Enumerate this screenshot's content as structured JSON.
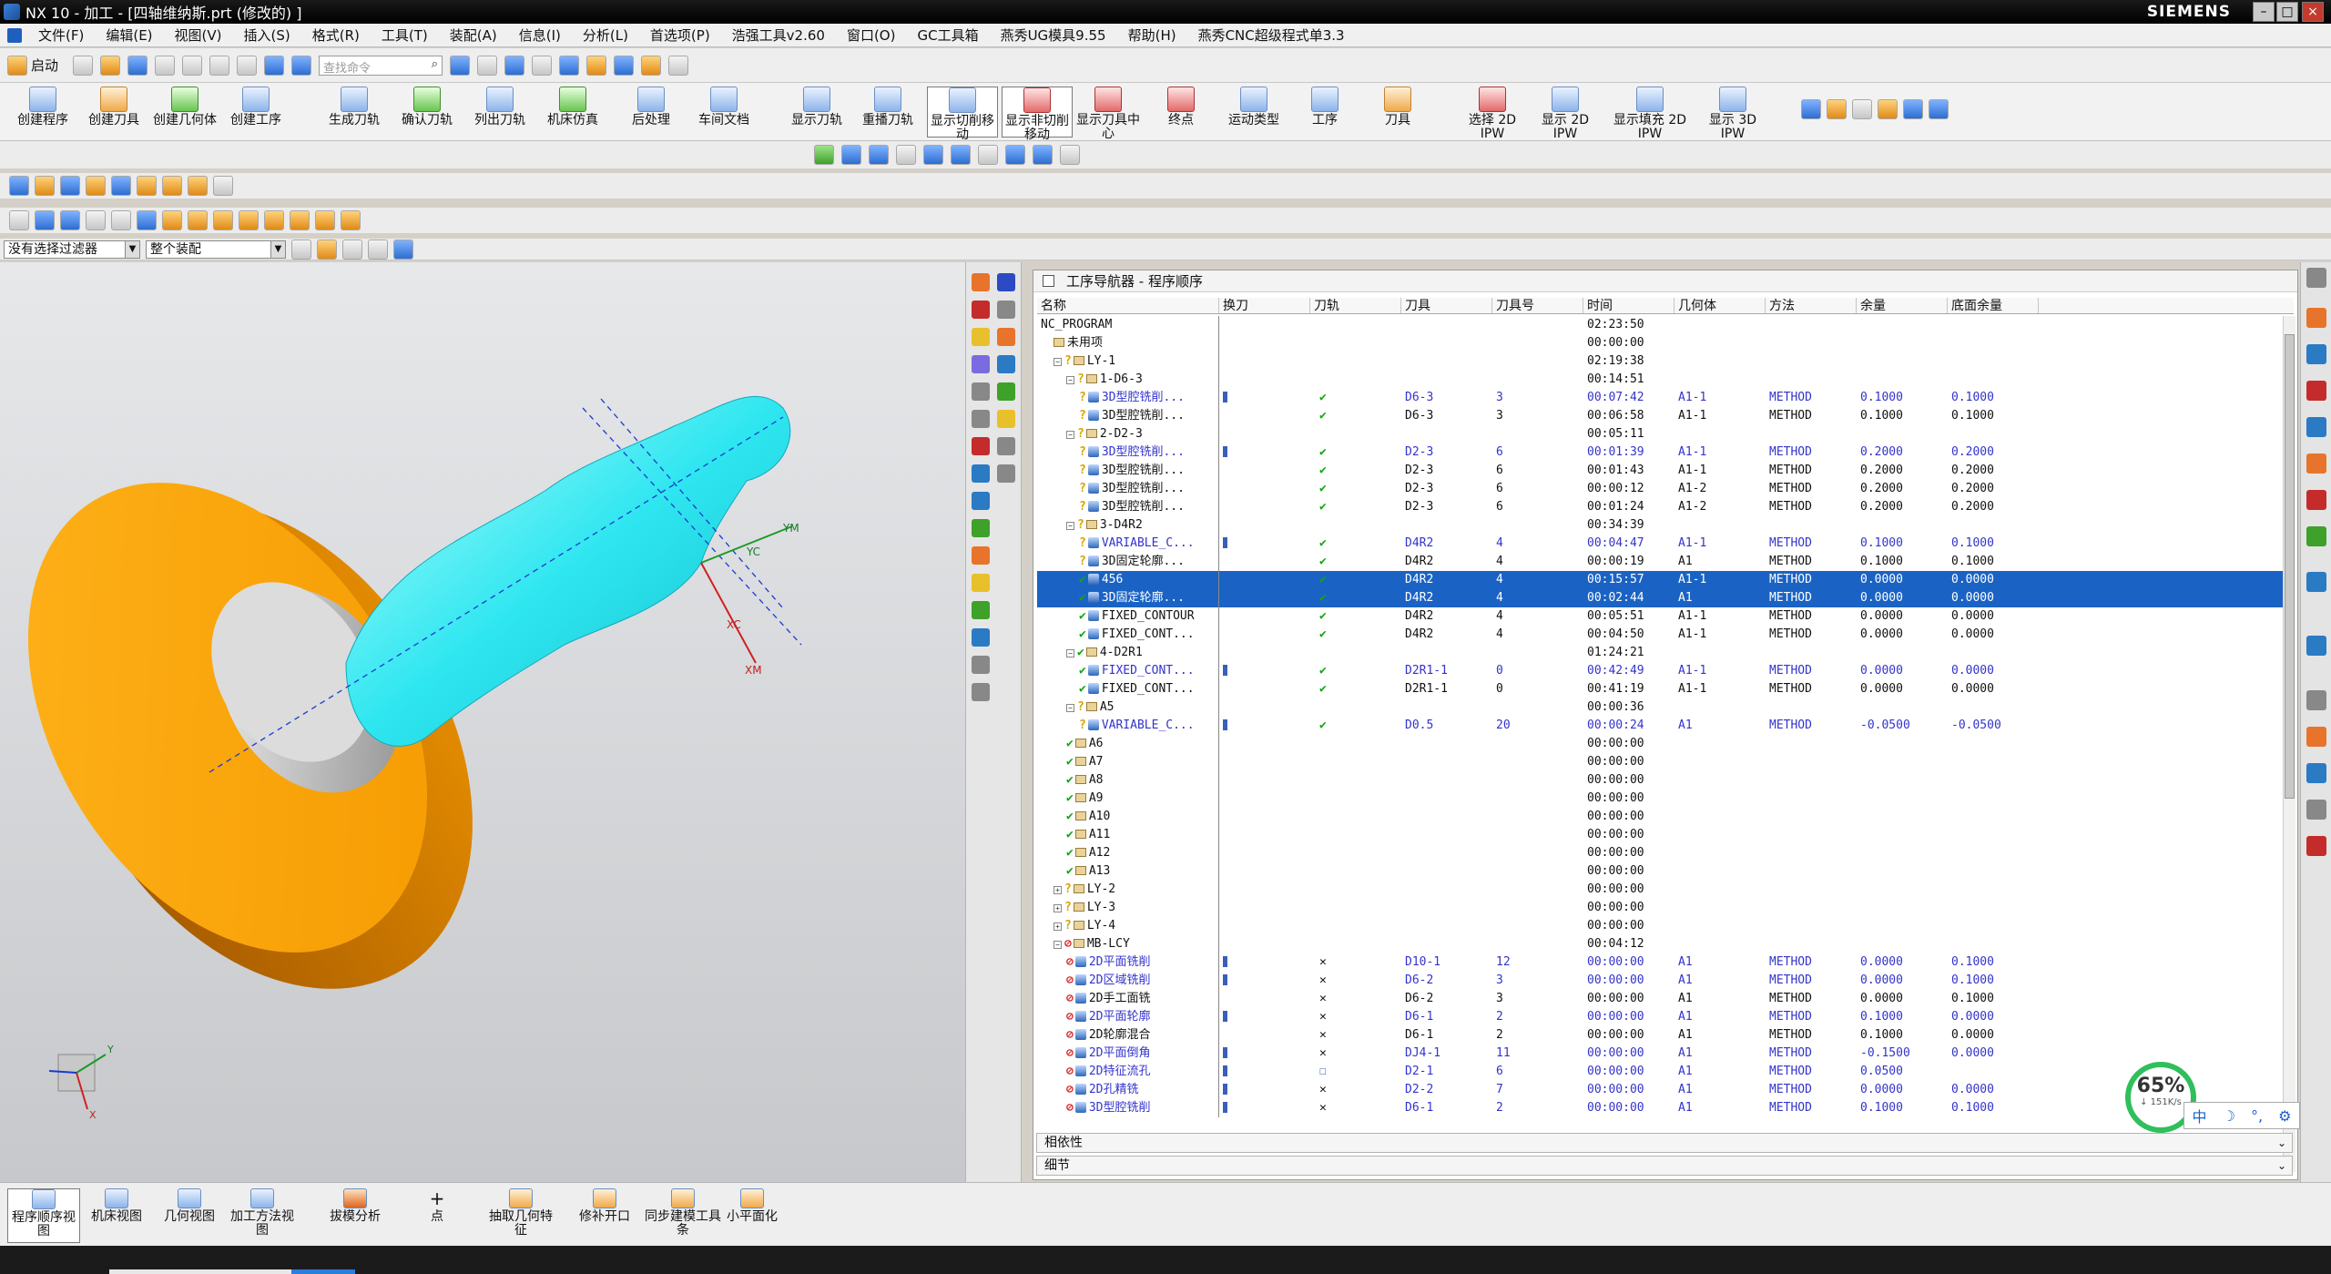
{
  "window": {
    "title": "NX 10 - 加工 - [四轴维纳斯.prt  (修改的) ]",
    "brand": "SIEMENS"
  },
  "menu": [
    "文件(F)",
    "编辑(E)",
    "视图(V)",
    "插入(S)",
    "格式(R)",
    "工具(T)",
    "装配(A)",
    "信息(I)",
    "分析(L)",
    "首选项(P)",
    "浩强工具v2.60",
    "窗口(O)",
    "GC工具箱",
    "燕秀UG模具9.55",
    "帮助(H)",
    "燕秀CNC超级程式单3.3"
  ],
  "quickbar": {
    "start_label": "启动",
    "search_placeholder": "查找命令"
  },
  "ribbon": [
    "创建程序",
    "创建刀具",
    "创建几何体",
    "创建工序",
    "生成刀轨",
    "确认刀轨",
    "列出刀轨",
    "机床仿真",
    "后处理",
    "车间文档",
    "显示刀轨",
    "重播刀轨",
    "显示切削移动",
    "显示非切削移动",
    "显示刀具中心",
    "终点",
    "运动类型",
    "工序",
    "刀具",
    "选择 2D IPW",
    "显示 2D IPW",
    "显示填充 2D IPW",
    "显示 3D IPW"
  ],
  "filter": {
    "selection_filter": "没有选择过滤器",
    "assembly_scope": "整个装配"
  },
  "navigator": {
    "title": "工序导航器 - 程序顺序",
    "columns": [
      "名称",
      "换刀",
      "刀轨",
      "刀具",
      "刀具号",
      "时间",
      "几何体",
      "方法",
      "余量",
      "底面余量"
    ],
    "rows": [
      {
        "name": "NC_PROGRAM",
        "indent": 0,
        "time": "02:23:50"
      },
      {
        "name": "未用项",
        "indent": 1,
        "time": "00:00:00",
        "icon": "group"
      },
      {
        "name": "LY-1",
        "indent": 1,
        "time": "02:19:38",
        "icon": "group",
        "toggle": "-",
        "status": "warn"
      },
      {
        "name": "1-D6-3",
        "indent": 2,
        "time": "00:14:51",
        "icon": "group",
        "toggle": "-",
        "status": "warn"
      },
      {
        "name": "3D型腔铣削...",
        "indent": 3,
        "tc": true,
        "path": "ok",
        "cutter": "D6-3",
        "num": "3",
        "time": "00:07:42",
        "geom": "A1-1",
        "meth": "METHOD",
        "stock": "0.1000",
        "floor": "0.1000",
        "blue": true,
        "status": "warn"
      },
      {
        "name": "3D型腔铣削...",
        "indent": 3,
        "path": "ok",
        "cutter": "D6-3",
        "num": "3",
        "time": "00:06:58",
        "geom": "A1-1",
        "meth": "METHOD",
        "stock": "0.1000",
        "floor": "0.1000",
        "status": "warn"
      },
      {
        "name": "2-D2-3",
        "indent": 2,
        "time": "00:05:11",
        "icon": "group",
        "toggle": "-",
        "status": "warn"
      },
      {
        "name": "3D型腔铣削...",
        "indent": 3,
        "tc": true,
        "path": "ok",
        "cutter": "D2-3",
        "num": "6",
        "time": "00:01:39",
        "geom": "A1-1",
        "meth": "METHOD",
        "stock": "0.2000",
        "floor": "0.2000",
        "blue": true,
        "status": "warn"
      },
      {
        "name": "3D型腔铣削...",
        "indent": 3,
        "path": "ok",
        "cutter": "D2-3",
        "num": "6",
        "time": "00:01:43",
        "geom": "A1-1",
        "meth": "METHOD",
        "stock": "0.2000",
        "floor": "0.2000",
        "status": "warn"
      },
      {
        "name": "3D型腔铣削...",
        "indent": 3,
        "path": "ok",
        "cutter": "D2-3",
        "num": "6",
        "time": "00:00:12",
        "geom": "A1-2",
        "meth": "METHOD",
        "stock": "0.2000",
        "floor": "0.2000",
        "status": "warn"
      },
      {
        "name": "3D型腔铣削...",
        "indent": 3,
        "path": "ok",
        "cutter": "D2-3",
        "num": "6",
        "time": "00:01:24",
        "geom": "A1-2",
        "meth": "METHOD",
        "stock": "0.2000",
        "floor": "0.2000",
        "status": "warn"
      },
      {
        "name": "3-D4R2",
        "indent": 2,
        "time": "00:34:39",
        "icon": "group",
        "toggle": "-",
        "status": "warn"
      },
      {
        "name": "VARIABLE_C...",
        "indent": 3,
        "tc": true,
        "path": "ok",
        "cutter": "D4R2",
        "num": "4",
        "time": "00:04:47",
        "geom": "A1-1",
        "meth": "METHOD",
        "stock": "0.1000",
        "floor": "0.1000",
        "blue": true,
        "status": "warn"
      },
      {
        "name": "3D固定轮廓...",
        "indent": 3,
        "path": "ok",
        "cutter": "D4R2",
        "num": "4",
        "time": "00:00:19",
        "geom": "A1",
        "meth": "METHOD",
        "stock": "0.1000",
        "floor": "0.1000",
        "status": "warn"
      },
      {
        "name": "456",
        "indent": 3,
        "path": "ok",
        "cutter": "D4R2",
        "num": "4",
        "time": "00:15:57",
        "geom": "A1-1",
        "meth": "METHOD",
        "stock": "0.0000",
        "floor": "0.0000",
        "sel": true,
        "status": "ok"
      },
      {
        "name": "3D固定轮廓...",
        "indent": 3,
        "path": "ok",
        "cutter": "D4R2",
        "num": "4",
        "time": "00:02:44",
        "geom": "A1",
        "meth": "METHOD",
        "stock": "0.0000",
        "floor": "0.0000",
        "sel": true,
        "status": "ok"
      },
      {
        "name": "FIXED_CONTOUR",
        "indent": 3,
        "path": "ok",
        "cutter": "D4R2",
        "num": "4",
        "time": "00:05:51",
        "geom": "A1-1",
        "meth": "METHOD",
        "stock": "0.0000",
        "floor": "0.0000",
        "status": "ok"
      },
      {
        "name": "FIXED_CONT...",
        "indent": 3,
        "path": "ok",
        "cutter": "D4R2",
        "num": "4",
        "time": "00:04:50",
        "geom": "A1-1",
        "meth": "METHOD",
        "stock": "0.0000",
        "floor": "0.0000",
        "status": "ok"
      },
      {
        "name": "4-D2R1",
        "indent": 2,
        "time": "01:24:21",
        "icon": "group",
        "toggle": "-",
        "status": "ok"
      },
      {
        "name": "FIXED_CONT...",
        "indent": 3,
        "tc": true,
        "path": "ok",
        "cutter": "D2R1-1",
        "num": "0",
        "time": "00:42:49",
        "geom": "A1-1",
        "meth": "METHOD",
        "stock": "0.0000",
        "floor": "0.0000",
        "blue": true,
        "status": "ok"
      },
      {
        "name": "FIXED_CONT...",
        "indent": 3,
        "path": "ok",
        "cutter": "D2R1-1",
        "num": "0",
        "time": "00:41:19",
        "geom": "A1-1",
        "meth": "METHOD",
        "stock": "0.0000",
        "floor": "0.0000",
        "status": "ok"
      },
      {
        "name": "A5",
        "indent": 2,
        "time": "00:00:36",
        "icon": "group",
        "toggle": "-",
        "status": "warn"
      },
      {
        "name": "VARIABLE_C...",
        "indent": 3,
        "tc": true,
        "path": "ok",
        "cutter": "D0.5",
        "num": "20",
        "time": "00:00:24",
        "geom": "A1",
        "meth": "METHOD",
        "stock": "-0.0500",
        "floor": "-0.0500",
        "blue": true,
        "status": "warn"
      },
      {
        "name": "A6",
        "indent": 2,
        "time": "00:00:00",
        "icon": "group",
        "status": "ok"
      },
      {
        "name": "A7",
        "indent": 2,
        "time": "00:00:00",
        "icon": "group",
        "status": "ok"
      },
      {
        "name": "A8",
        "indent": 2,
        "time": "00:00:00",
        "icon": "group",
        "status": "ok"
      },
      {
        "name": "A9",
        "indent": 2,
        "time": "00:00:00",
        "icon": "group",
        "status": "ok"
      },
      {
        "name": "A10",
        "indent": 2,
        "time": "00:00:00",
        "icon": "group",
        "status": "ok"
      },
      {
        "name": "A11",
        "indent": 2,
        "time": "00:00:00",
        "icon": "group",
        "status": "ok"
      },
      {
        "name": "A12",
        "indent": 2,
        "time": "00:00:00",
        "icon": "group",
        "status": "ok"
      },
      {
        "name": "A13",
        "indent": 2,
        "time": "00:00:00",
        "icon": "group",
        "status": "ok"
      },
      {
        "name": "LY-2",
        "indent": 1,
        "time": "00:00:00",
        "icon": "group",
        "toggle": "+",
        "status": "warn"
      },
      {
        "name": "LY-3",
        "indent": 1,
        "time": "00:00:00",
        "icon": "group",
        "toggle": "+",
        "status": "warn"
      },
      {
        "name": "LY-4",
        "indent": 1,
        "time": "00:00:00",
        "icon": "group",
        "toggle": "+",
        "status": "warn"
      },
      {
        "name": "MB-LCY",
        "indent": 1,
        "time": "00:04:12",
        "icon": "group",
        "toggle": "-",
        "status": "no"
      },
      {
        "name": "2D平面铣削",
        "indent": 2,
        "tc": true,
        "path": "x",
        "cutter": "D10-1",
        "num": "12",
        "time": "00:00:00",
        "geom": "A1",
        "meth": "METHOD",
        "stock": "0.0000",
        "floor": "0.1000",
        "blue": true,
        "status": "no"
      },
      {
        "name": "2D区域铣削",
        "indent": 2,
        "tc": true,
        "path": "x",
        "cutter": "D6-2",
        "num": "3",
        "time": "00:00:00",
        "geom": "A1",
        "meth": "METHOD",
        "stock": "0.0000",
        "floor": "0.1000",
        "blue": true,
        "status": "no"
      },
      {
        "name": "2D手工面铣",
        "indent": 2,
        "path": "x",
        "cutter": "D6-2",
        "num": "3",
        "time": "00:00:00",
        "geom": "A1",
        "meth": "METHOD",
        "stock": "0.0000",
        "floor": "0.1000",
        "status": "no"
      },
      {
        "name": "2D平面轮廓",
        "indent": 2,
        "tc": true,
        "path": "x",
        "cutter": "D6-1",
        "num": "2",
        "time": "00:00:00",
        "geom": "A1",
        "meth": "METHOD",
        "stock": "0.1000",
        "floor": "0.0000",
        "blue": true,
        "status": "no"
      },
      {
        "name": "2D轮廓混合",
        "indent": 2,
        "path": "x",
        "cutter": "D6-1",
        "num": "2",
        "time": "00:00:00",
        "geom": "A1",
        "meth": "METHOD",
        "stock": "0.1000",
        "floor": "0.0000",
        "status": "no"
      },
      {
        "name": "2D平面倒角",
        "indent": 2,
        "tc": true,
        "path": "x",
        "cutter": "DJ4-1",
        "num": "11",
        "time": "00:00:00",
        "geom": "A1",
        "meth": "METHOD",
        "stock": "-0.1500",
        "floor": "0.0000",
        "blue": true,
        "status": "no"
      },
      {
        "name": "2D特征流孔",
        "indent": 2,
        "tc": true,
        "path": "box",
        "cutter": "D2-1",
        "num": "6",
        "time": "00:00:00",
        "geom": "A1",
        "meth": "METHOD",
        "stock": "0.0500",
        "floor": "",
        "blue": true,
        "status": "no"
      },
      {
        "name": "2D孔精铣",
        "indent": 2,
        "tc": true,
        "path": "x",
        "cutter": "D2-2",
        "num": "7",
        "time": "00:00:00",
        "geom": "A1",
        "meth": "METHOD",
        "stock": "0.0000",
        "floor": "0.0000",
        "blue": true,
        "status": "no"
      },
      {
        "name": "3D型腔铣削",
        "indent": 2,
        "tc": true,
        "path": "x",
        "cutter": "D6-1",
        "num": "2",
        "time": "00:00:00",
        "geom": "A1",
        "meth": "METHOD",
        "stock": "0.1000",
        "floor": "0.1000",
        "blue": true,
        "status": "no"
      }
    ]
  },
  "panels": {
    "dependencies": "相依性",
    "details": "细节"
  },
  "bottom": [
    "程序顺序视图",
    "机床视图",
    "几何视图",
    "加工方法视图",
    "拔模分析",
    "点",
    "抽取几何特征",
    "修补开口",
    "同步建模工具条",
    "小平面化"
  ],
  "viewport": {
    "axis_labels": [
      "YM",
      "YC",
      "XC",
      "XM"
    ],
    "triad_labels": [
      "Y",
      "X"
    ]
  },
  "network": {
    "percent": "65%",
    "speed": "↓ 151K/s"
  },
  "ime": [
    "中",
    "☽",
    "°,",
    "⚙"
  ]
}
